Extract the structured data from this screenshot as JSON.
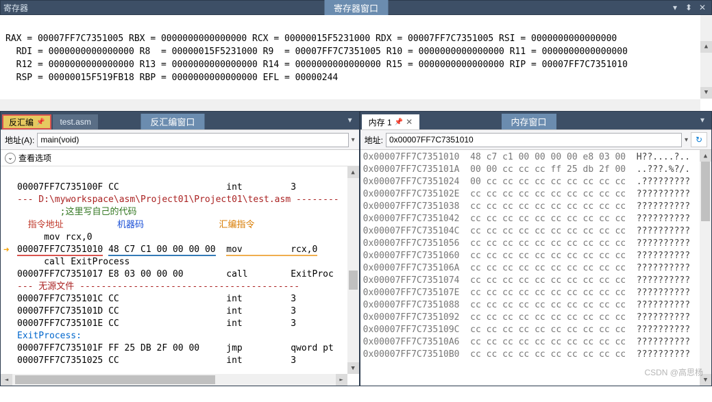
{
  "registers_panel": {
    "title": "寄存器",
    "center_title": "寄存器窗口",
    "lines": [
      "RAX = 00007FF7C7351005 RBX = 0000000000000000 RCX = 00000015F5231000 RDX = 00007FF7C7351005 RSI = 0000000000000000 ",
      "  RDI = 0000000000000000 R8  = 00000015F5231000 R9  = 00007FF7C7351005 R10 = 0000000000000000 R11 = 0000000000000000 ",
      "  R12 = 0000000000000000 R13 = 0000000000000000 R14 = 0000000000000000 R15 = 0000000000000000 RIP = 00007FF7C7351010 ",
      "  RSP = 00000015F519FB18 RBP = 0000000000000000 EFL = 00000244 "
    ]
  },
  "disasm": {
    "tabs": {
      "active": "反汇编",
      "other": "test.asm"
    },
    "center_title": "反汇编窗口",
    "addr_label": "地址(A):",
    "addr_value": "main(void)",
    "options_label": "查看选项",
    "annot": {
      "addr": "指令地址",
      "bytes": "机器码",
      "mnem": "汇编指令"
    },
    "lines": {
      "l0": {
        "a": "00007FF7C735100F",
        "b": "CC",
        "m": "int",
        "o": "3"
      },
      "path": "--- D:\\myworkspace\\asm\\Project01\\Project01\\test.asm --------",
      "comment": ";这里写自己的代码",
      "pre_mov": "     mov rcx,0",
      "cur": {
        "a": "00007FF7C7351010",
        "b": "48 C7 C1 00 00 00 00",
        "m": "mov",
        "o": "rcx,0"
      },
      "call_line": "     call ExitProcess",
      "l5": {
        "a": "00007FF7C7351017",
        "b": "E8 03 00 00 00",
        "m": "call",
        "o": "ExitProc"
      },
      "nosrc": "--- 无源文件 -----------------------------------------",
      "l6": {
        "a": "00007FF7C735101C",
        "b": "CC",
        "m": "int",
        "o": "3"
      },
      "l7": {
        "a": "00007FF7C735101D",
        "b": "CC",
        "m": "int",
        "o": "3"
      },
      "l8": {
        "a": "00007FF7C735101E",
        "b": "CC",
        "m": "int",
        "o": "3"
      },
      "exitproc": "ExitProcess:",
      "l9": {
        "a": "00007FF7C735101F",
        "b": "FF 25 DB 2F 00 00",
        "m": "jmp",
        "o": "qword pt"
      },
      "l10": {
        "a": "00007FF7C7351025",
        "b": "CC",
        "m": "int",
        "o": "3"
      }
    }
  },
  "memory": {
    "tab": "内存 1",
    "center_title": "内存窗口",
    "addr_label": "地址:",
    "addr_value": "0x00007FF7C7351010",
    "rows": [
      {
        "a": "0x00007FF7C7351010",
        "b": "48 c7 c1 00 00 00 00 e8 03 00",
        "s": "H??....?.."
      },
      {
        "a": "0x00007FF7C735101A",
        "b": "00 00 cc cc cc ff 25 db 2f 00",
        "s": "..???.%?/."
      },
      {
        "a": "0x00007FF7C7351024",
        "b": "00 cc cc cc cc cc cc cc cc cc",
        "s": ".?????????"
      },
      {
        "a": "0x00007FF7C735102E",
        "b": "cc cc cc cc cc cc cc cc cc cc",
        "s": "??????????"
      },
      {
        "a": "0x00007FF7C7351038",
        "b": "cc cc cc cc cc cc cc cc cc cc",
        "s": "??????????"
      },
      {
        "a": "0x00007FF7C7351042",
        "b": "cc cc cc cc cc cc cc cc cc cc",
        "s": "??????????"
      },
      {
        "a": "0x00007FF7C735104C",
        "b": "cc cc cc cc cc cc cc cc cc cc",
        "s": "??????????"
      },
      {
        "a": "0x00007FF7C7351056",
        "b": "cc cc cc cc cc cc cc cc cc cc",
        "s": "??????????"
      },
      {
        "a": "0x00007FF7C7351060",
        "b": "cc cc cc cc cc cc cc cc cc cc",
        "s": "??????????"
      },
      {
        "a": "0x00007FF7C735106A",
        "b": "cc cc cc cc cc cc cc cc cc cc",
        "s": "??????????"
      },
      {
        "a": "0x00007FF7C7351074",
        "b": "cc cc cc cc cc cc cc cc cc cc",
        "s": "??????????"
      },
      {
        "a": "0x00007FF7C735107E",
        "b": "cc cc cc cc cc cc cc cc cc cc",
        "s": "??????????"
      },
      {
        "a": "0x00007FF7C7351088",
        "b": "cc cc cc cc cc cc cc cc cc cc",
        "s": "??????????"
      },
      {
        "a": "0x00007FF7C7351092",
        "b": "cc cc cc cc cc cc cc cc cc cc",
        "s": "??????????"
      },
      {
        "a": "0x00007FF7C735109C",
        "b": "cc cc cc cc cc cc cc cc cc cc",
        "s": "??????????"
      },
      {
        "a": "0x00007FF7C73510A6",
        "b": "cc cc cc cc cc cc cc cc cc cc",
        "s": "??????????"
      },
      {
        "a": "0x00007FF7C73510B0",
        "b": "cc cc cc cc cc cc cc cc cc cc",
        "s": "??????????"
      }
    ],
    "watermark": "CSDN @高思杨"
  }
}
